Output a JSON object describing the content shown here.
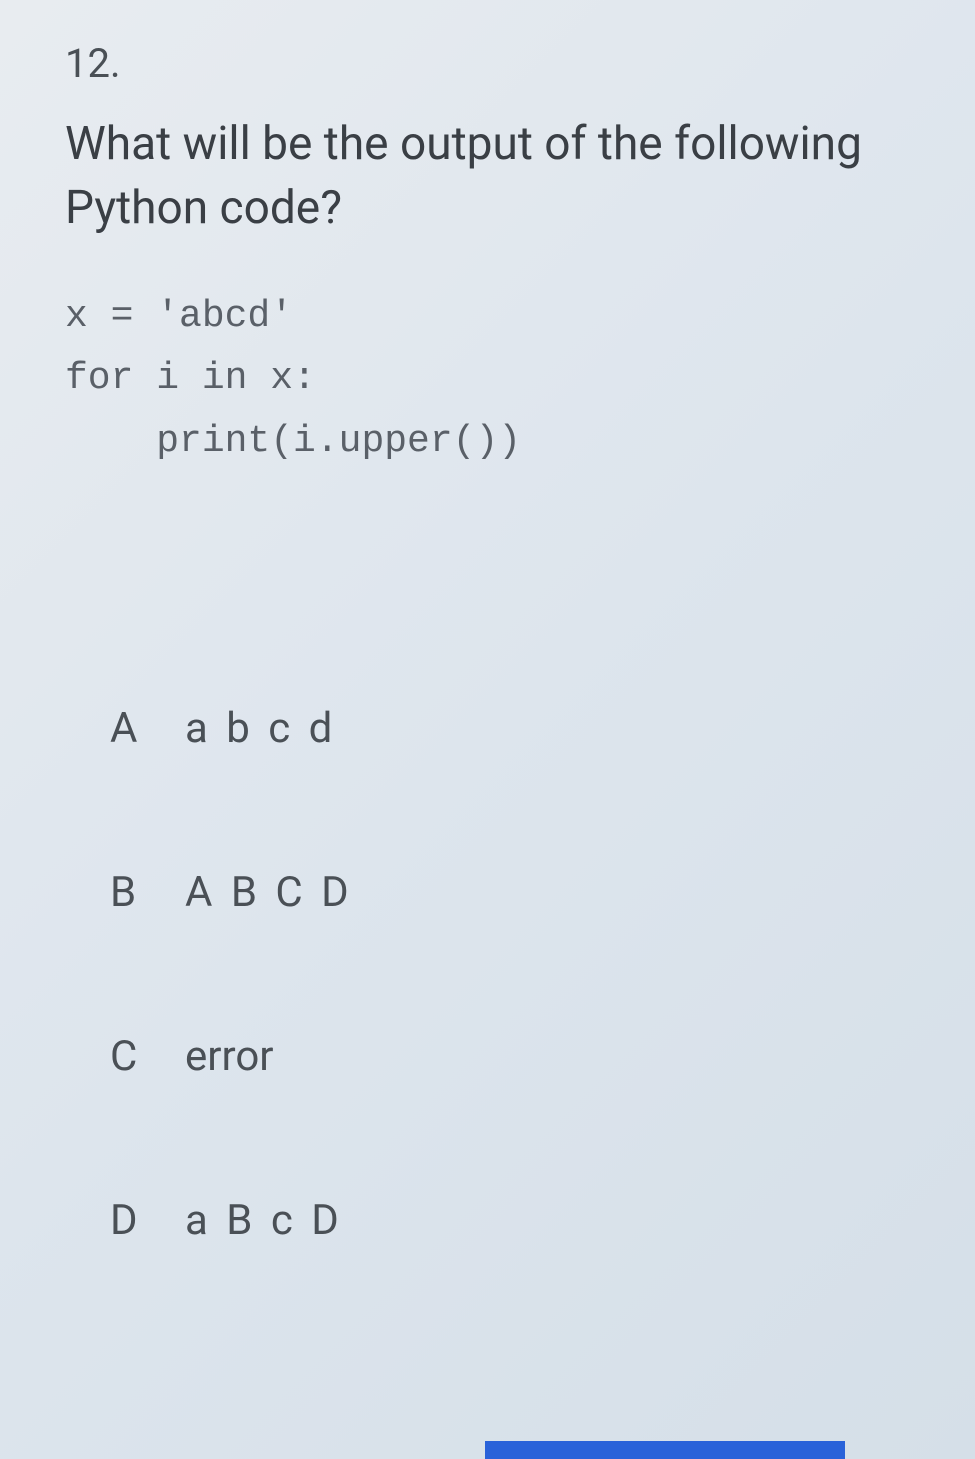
{
  "question": {
    "number": "12.",
    "text": "What will be the output of the following Python code?"
  },
  "code": {
    "line1": "x = 'abcd'",
    "line2": "for i in x:",
    "line3": "    print(i.upper())"
  },
  "options": [
    {
      "letter": "A",
      "text": "a b c d",
      "spaced": true
    },
    {
      "letter": "B",
      "text": "A B C D",
      "spaced": true
    },
    {
      "letter": "C",
      "text": "error",
      "spaced": false
    },
    {
      "letter": "D",
      "text": "a B c D",
      "spaced": true
    }
  ]
}
